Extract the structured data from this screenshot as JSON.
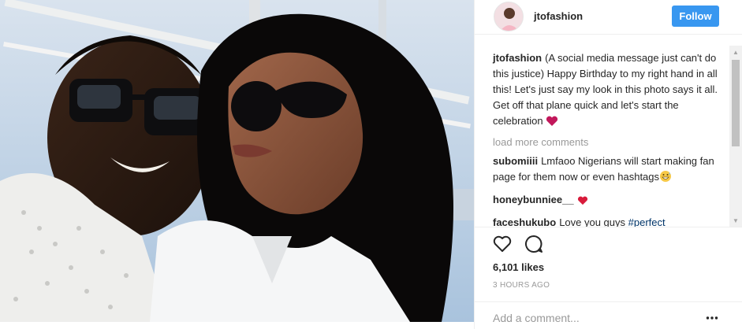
{
  "post": {
    "username": "jtofashion",
    "follow_label": "Follow",
    "caption": {
      "username": "jtofashion",
      "text": "(A social media message just can't do this justice) Happy Birthday to my right hand in all this! Let's just say my look in this photo says it all. Get off that plane quick and let's start the celebration",
      "emoji": "heart-icon"
    },
    "load_more_label": "load more comments",
    "comments": [
      {
        "username": "subomiiii",
        "text": "Lmfaoo Nigerians will start making fan page for them now or even hashtags",
        "emoji": "grinning-sweat-face"
      },
      {
        "username": "honeybunniee__",
        "text": "",
        "emoji": "heart-icon"
      },
      {
        "username": "faceshukubo",
        "text": "Love you guys",
        "tag": "#perfect"
      }
    ],
    "likes": "6,101 likes",
    "time_ago": "3 HOURS AGO",
    "add_comment_placeholder": "Add a comment...",
    "colors": {
      "accent": "#3897f0",
      "text": "#262626",
      "muted": "#999999",
      "heart": "#ed4956"
    }
  }
}
